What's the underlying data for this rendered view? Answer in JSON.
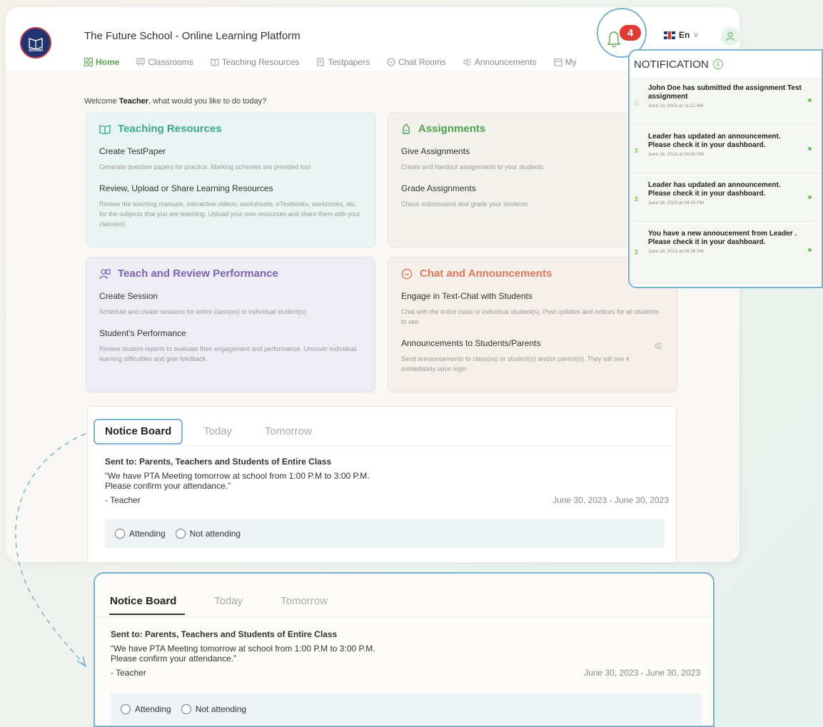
{
  "app": {
    "title": "The Future School - Online Learning Platform",
    "logo_text": "School",
    "language": "En"
  },
  "nav": {
    "items": [
      {
        "label": "Home",
        "icon": "grid-icon"
      },
      {
        "label": "Classrooms",
        "icon": "board-icon"
      },
      {
        "label": "Teaching Resources",
        "icon": "book-icon"
      },
      {
        "label": "Testpapers",
        "icon": "testpaper-icon"
      },
      {
        "label": "Chat Rooms",
        "icon": "chat-icon"
      },
      {
        "label": "Announcements",
        "icon": "megaphone-icon"
      },
      {
        "label": "My",
        "icon": "calendar-icon"
      }
    ]
  },
  "notifications": {
    "badge_count": "4",
    "header": "NOTIFICATION",
    "header_count": "4",
    "items": [
      {
        "text": "John Doe has submitted the assignment Test assignment",
        "date": "June 19, 2023 at 11:21 AM"
      },
      {
        "text": "Leader has updated an announcement. Please check it in your dashboard.",
        "date": "June 18, 2023 at 04:45 PM"
      },
      {
        "text": "Leader has updated an announcement. Please check it in your dashboard.",
        "date": "June 18, 2023 at 04:45 PM"
      },
      {
        "text": "You have a new annoucement from Leader . Please check it in your dashboard.",
        "date": "June 18, 2023 at 04:38 PM"
      }
    ]
  },
  "welcome": {
    "prefix": "Welcome ",
    "name": "Teacher",
    "suffix": ", what would you like to do today?"
  },
  "cards": {
    "teaching": {
      "title": "Teaching Resources",
      "s1": "Create TestPaper",
      "d1": "Generate question papers for practice. Marking schemes are provided too!",
      "s2": "Review, Upload or Share Learning Resources",
      "d2": "Review the teaching manuals, interactive videos, worksheets, eTextbooks, workbooks, etc, for the subjects that you are teaching. Upload your own resources and share them with your class(es)."
    },
    "assignments": {
      "title": "Assignments",
      "s1": "Give Assignments",
      "d1": "Create and handout assignments to your students",
      "s2": "Grade Assignments",
      "d2": "Check submissions and grade your students"
    },
    "performance": {
      "title": "Teach and Review Performance",
      "s1": "Create Session",
      "d1": "Schedule and create sessions for entire class(es) or individual student(s)",
      "s2": "Student's Performance",
      "d2": "Review student reports to evaluate their engagement and performance. Uncover individual learning difficulties and give feedback."
    },
    "chat": {
      "title": "Chat and Announcements",
      "s1": "Engage in Text-Chat with Students",
      "d1": "Chat with the entire class or individual student(s). Post updates and notices for all students to see",
      "s2": "Announcements to Students/Parents",
      "d2": "Send announcements to class(es) or student(s) and/or parent(s). They will see it immediately upon login"
    }
  },
  "notice_board": {
    "tabs": [
      "Notice Board",
      "Today",
      "Tomorrow"
    ],
    "sent_to": "Sent to: Parents, Teachers and Students of Entire Class",
    "message_line1": "“We have PTA Meeting tomorrow at school from 1:00 P.M to 3:00 P.M.",
    "message_line2": "Please confirm your attendance.”",
    "author": "- Teacher",
    "date_range": "June 30, 2023 - June 30, 2023",
    "options": [
      "Attending",
      "Not attending"
    ]
  },
  "colors": {
    "accent_green": "#5aa64a",
    "highlight_blue": "#7bb3d0",
    "badge_red": "#e23a33"
  }
}
